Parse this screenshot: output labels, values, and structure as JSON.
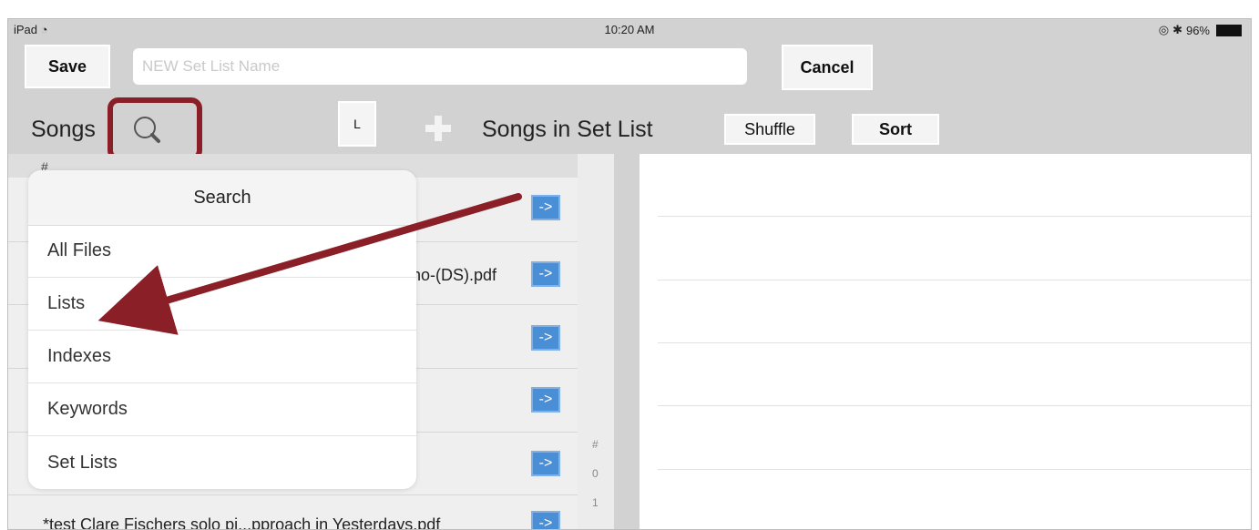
{
  "status_bar": {
    "device": "iPad",
    "time": "10:20 AM",
    "battery": "96%"
  },
  "toolbar": {
    "save_label": "Save",
    "name_placeholder": "NEW Set List Name",
    "cancel_label": "Cancel"
  },
  "header": {
    "songs_label": "Songs",
    "letter_button": "L",
    "set_list_label": "Songs in Set List",
    "shuffle_label": "Shuffle",
    "sort_label": "Sort"
  },
  "songs_list": {
    "section_header": "#",
    "rows": [
      {
        "text": "",
        "button": "->"
      },
      {
        "text": "no-(DS).pdf",
        "button": "->"
      },
      {
        "text": "",
        "button": "->"
      },
      {
        "text": "",
        "button": "->"
      },
      {
        "text": "",
        "button": "->"
      },
      {
        "text": "*test Clare Fischers solo pi...pproach in Yesterdays.pdf",
        "button": "->"
      }
    ]
  },
  "index_column": [
    "#",
    "0",
    "1"
  ],
  "search_popover": {
    "title": "Search",
    "items": [
      "All Files",
      "Lists",
      "Indexes",
      "Keywords",
      "Set Lists"
    ]
  },
  "colors": {
    "highlight": "#8a1f27",
    "arrow_button": "#4a8fd6",
    "background": "#d2d2d2"
  }
}
